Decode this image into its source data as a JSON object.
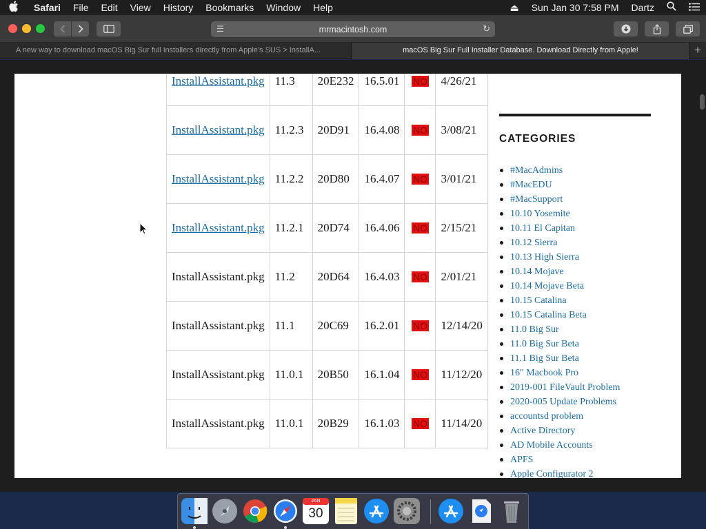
{
  "menubar": {
    "app_name": "Safari",
    "menus": [
      "File",
      "Edit",
      "View",
      "History",
      "Bookmarks",
      "Window",
      "Help"
    ],
    "datetime": "Sun Jan 30  7:58 PM",
    "user": "Dartz"
  },
  "browser": {
    "address": "mrmacintosh.com",
    "tabs": [
      {
        "title": "A new way to download macOS Big Sur full installers directly from Apple's SUS > InstallA..."
      },
      {
        "title": "macOS Big Sur Full Installer Database. Download Directly from Apple!"
      }
    ]
  },
  "installer_table": {
    "rows": [
      {
        "name": "InstallAssistant.pkg",
        "linked": true,
        "version": "11.3",
        "build": "20E232",
        "ver2": "16.5.01",
        "flag": "NO",
        "date": "4/26/21"
      },
      {
        "name": "InstallAssistant.pkg",
        "linked": true,
        "version": "11.2.3",
        "build": "20D91",
        "ver2": "16.4.08",
        "flag": "NO",
        "date": "3/08/21"
      },
      {
        "name": "InstallAssistant.pkg",
        "linked": true,
        "version": "11.2.2",
        "build": "20D80",
        "ver2": "16.4.07",
        "flag": "NO",
        "date": "3/01/21"
      },
      {
        "name": "InstallAssistant.pkg",
        "linked": true,
        "version": "11.2.1",
        "build": "20D74",
        "ver2": "16.4.06",
        "flag": "NO",
        "date": "2/15/21"
      },
      {
        "name": "InstallAssistant.pkg",
        "linked": false,
        "version": "11.2",
        "build": "20D64",
        "ver2": "16.4.03",
        "flag": "NO",
        "date": "2/01/21"
      },
      {
        "name": "InstallAssistant.pkg",
        "linked": false,
        "version": "11.1",
        "build": "20C69",
        "ver2": "16.2.01",
        "flag": "NO",
        "date": "12/14/20"
      },
      {
        "name": "InstallAssistant.pkg",
        "linked": false,
        "version": "11.0.1",
        "build": "20B50",
        "ver2": "16.1.04",
        "flag": "NO",
        "date": "11/12/20"
      },
      {
        "name": "InstallAssistant.pkg",
        "linked": false,
        "version": "11.0.1",
        "build": "20B29",
        "ver2": "16.1.03",
        "flag": "NO",
        "date": "11/14/20"
      }
    ]
  },
  "sidebar": {
    "heading": "CATEGORIES",
    "items": [
      "#MacAdmins",
      "#MacEDU",
      "#MacSupport",
      "10.10 Yosemite",
      "10.11 El Capitan",
      "10.12 Sierra",
      "10.13 High Sierra",
      "10.14 Mojave",
      "10.14 Mojave Beta",
      "10.15 Catalina",
      "10.15 Catalina Beta",
      "11.0 Big Sur",
      "11.0 Big Sur Beta",
      "11.1 Big Sur Beta",
      "16\" Macbook Pro",
      "2019-001 FileVault Problem",
      "2020-005 Update Problems",
      "accountsd problem",
      "Active Directory",
      "AD Mobile Accounts",
      "APFS",
      "Apple Configurator 2"
    ]
  },
  "dock": {
    "calendar": {
      "month": "JAN",
      "day": "30"
    },
    "colors": {
      "finder": "#3b8ee6",
      "launchpad": "#9aa0a8",
      "chrome": "#e9e9e9",
      "safari": "#2a7ef0",
      "notes": "#f5d54a",
      "appstore": "#1d8ff2",
      "prefs": "#8d8d8d",
      "trash": "#8f9499"
    }
  }
}
